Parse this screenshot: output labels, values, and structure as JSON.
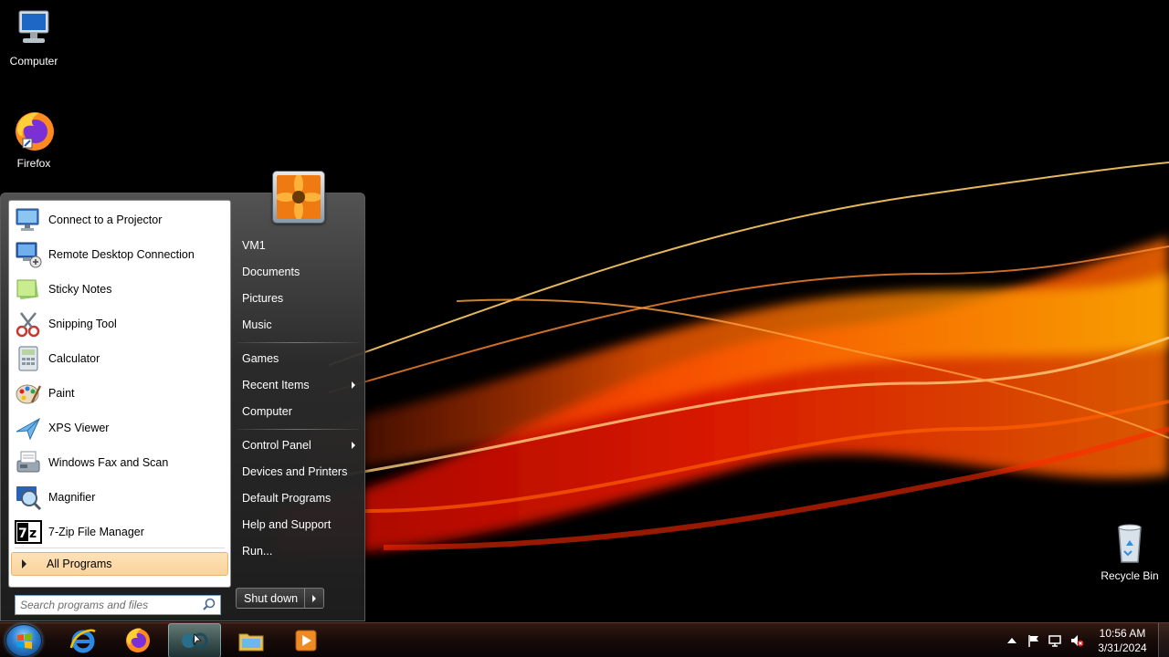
{
  "desktop": {
    "icons": [
      {
        "label": "Computer"
      },
      {
        "label": "Firefox"
      },
      {
        "label": "Recycle Bin"
      }
    ]
  },
  "start_menu": {
    "programs": [
      {
        "label": "Connect to a Projector",
        "icon": "projector-icon"
      },
      {
        "label": "Remote Desktop Connection",
        "icon": "remote-desktop-icon"
      },
      {
        "label": "Sticky Notes",
        "icon": "sticky-notes-icon"
      },
      {
        "label": "Snipping Tool",
        "icon": "scissors-icon"
      },
      {
        "label": "Calculator",
        "icon": "calculator-icon"
      },
      {
        "label": "Paint",
        "icon": "paint-palette-icon"
      },
      {
        "label": "XPS Viewer",
        "icon": "xps-viewer-icon"
      },
      {
        "label": "Windows Fax and Scan",
        "icon": "fax-icon"
      },
      {
        "label": "Magnifier",
        "icon": "magnifier-icon"
      },
      {
        "label": "7-Zip File Manager",
        "icon": "7zip-icon"
      }
    ],
    "all_programs": "All Programs",
    "search_placeholder": "Search programs and files",
    "right_items": [
      {
        "label": "VM1"
      },
      {
        "label": "Documents"
      },
      {
        "label": "Pictures"
      },
      {
        "label": "Music"
      },
      {
        "label": "Games"
      },
      {
        "label": "Recent Items",
        "submenu": true
      },
      {
        "label": "Computer"
      },
      {
        "label": "Control Panel",
        "submenu": true
      },
      {
        "label": "Devices and Printers"
      },
      {
        "label": "Default Programs"
      },
      {
        "label": "Help and Support"
      },
      {
        "label": "Run..."
      }
    ],
    "shutdown_label": "Shut down"
  },
  "taskbar": {
    "pinned": [
      {
        "name": "internet-explorer-icon"
      },
      {
        "name": "firefox-icon"
      },
      {
        "name": "network-app-icon",
        "active": true
      },
      {
        "name": "file-explorer-icon"
      },
      {
        "name": "media-player-icon"
      }
    ],
    "clock": {
      "time": "10:56 AM",
      "date": "3/31/2024"
    }
  },
  "colors": {
    "accent_hover": "#fbd39b",
    "wallpaper_red": "#ff2a00",
    "wallpaper_orange": "#ff9a00"
  }
}
